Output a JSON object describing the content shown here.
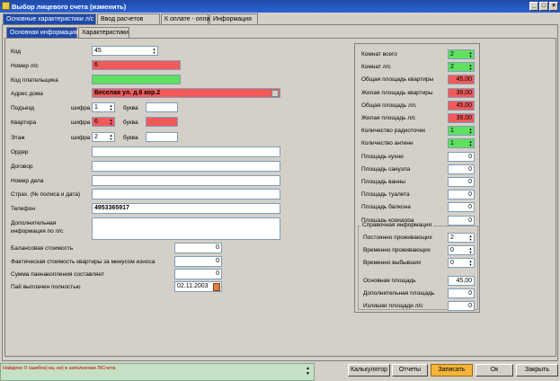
{
  "window": {
    "title": "Выбор лицевого счета (изменить)",
    "minimize": "_",
    "maximize": "□",
    "close": "×"
  },
  "main_tabs": [
    "Основные характеристики л/с",
    "Ввод расчетов",
    "К оплате - оплачено",
    "Информация"
  ],
  "sub_tabs": [
    "Основная информация",
    "Характеристики"
  ],
  "left": {
    "kod": {
      "label": "Код",
      "value": "45"
    },
    "nomer_ls": {
      "label": "Номер л/с",
      "value": "6"
    },
    "kod_plat": {
      "label": "Код плательщика",
      "value": ""
    },
    "adres": {
      "label": "Адрес дома",
      "value": "Веселая ул. д.6 кор.2"
    },
    "podezd": {
      "label": "Подъезд",
      "cifra_label": "шифра",
      "cifra": "1",
      "bukva_label": "буква",
      "bukva": ""
    },
    "kvartira": {
      "label": "Квартира",
      "cifra_label": "шифра",
      "cifra": "6",
      "bukva_label": "буква",
      "bukva": ""
    },
    "etazh": {
      "label": "Этаж",
      "cifra_label": "шифра",
      "cifra": "2",
      "bukva_label": "буква",
      "bukva": ""
    },
    "order": {
      "label": "Ордер",
      "value": ""
    },
    "dogovor": {
      "label": "Договор",
      "value": ""
    },
    "nomer_dela": {
      "label": "Номер дела",
      "value": ""
    },
    "strah": {
      "label": "Страх. (№ полиса и дата)",
      "value": ""
    },
    "telefon": {
      "label": "Телефон",
      "value": "4953365917"
    },
    "dop_info": {
      "label1": "Дополнительная",
      "label2": "информация по л/с",
      "value": ""
    },
    "balans": {
      "label": "Балансовая стоимость",
      "value": "0"
    },
    "fakt": {
      "label": "Фактическая стоимость квартиры за минусом износа",
      "value": "0"
    },
    "summa": {
      "label": "Сумма паенакопления составляет",
      "value": "0"
    },
    "pai": {
      "label": "Пай выплачен полностью",
      "value": "02.11.2003"
    }
  },
  "right": {
    "rows": [
      {
        "label": "Комнат всего",
        "value": "2",
        "style": "green",
        "spin": true
      },
      {
        "label": "Комнат л/с",
        "value": "2",
        "style": "green",
        "spin": true
      },
      {
        "label": "Общая площадь квартиры",
        "value": "45,00",
        "style": "red",
        "spin": false
      },
      {
        "label": "Жилая площадь квартиры",
        "value": "39,00",
        "style": "red",
        "spin": false
      },
      {
        "label": "Общая площадь л/с",
        "value": "45,00",
        "style": "red",
        "spin": false
      },
      {
        "label": "Жилая площадь л/с",
        "value": "39,00",
        "style": "red",
        "spin": false
      },
      {
        "label": "Количество радиоточек",
        "value": "1",
        "style": "green",
        "spin": true
      },
      {
        "label": "Количество антенн",
        "value": "1",
        "style": "green",
        "spin": true
      },
      {
        "label": "Площадь кухни",
        "value": "0",
        "style": "",
        "spin": false
      },
      {
        "label": "Площадь санузла",
        "value": "0",
        "style": "",
        "spin": false
      },
      {
        "label": "Площадь ванны",
        "value": "0",
        "style": "",
        "spin": false
      },
      {
        "label": "Площадь туалета",
        "value": "0",
        "style": "",
        "spin": false
      },
      {
        "label": "Площадь балкона",
        "value": "0",
        "style": "",
        "spin": false
      },
      {
        "label": "Площадь коридора",
        "value": "0",
        "style": "",
        "spin": false
      }
    ],
    "ref": {
      "title": "Справочная информация",
      "rows": [
        {
          "label": "Постоянно проживающих",
          "value": "2",
          "spin": true
        },
        {
          "label": "Временно проживающих",
          "value": "0",
          "spin": true
        },
        {
          "label": "Временно выбывших",
          "value": "0",
          "spin": true
        },
        {
          "label": "Основная площадь",
          "value": "45,00",
          "spin": false
        },
        {
          "label": "Дополнительная площадь",
          "value": "0",
          "spin": false
        },
        {
          "label": "Излишки площади л/с",
          "value": "0",
          "spin": false
        }
      ]
    }
  },
  "status": {
    "text": "Найдено 0 ошибок(-ка,-ки) в заполнении Л/Счета"
  },
  "buttons": {
    "calc": "Калькулятор",
    "reports": "Отчеты",
    "save": "Записать",
    "ok": "Ок",
    "close": "Закрыть"
  },
  "colors": {
    "title": "#1f4aa8",
    "red": "#f25a5a",
    "green": "#5fe05f",
    "save": "#f2b43a"
  }
}
